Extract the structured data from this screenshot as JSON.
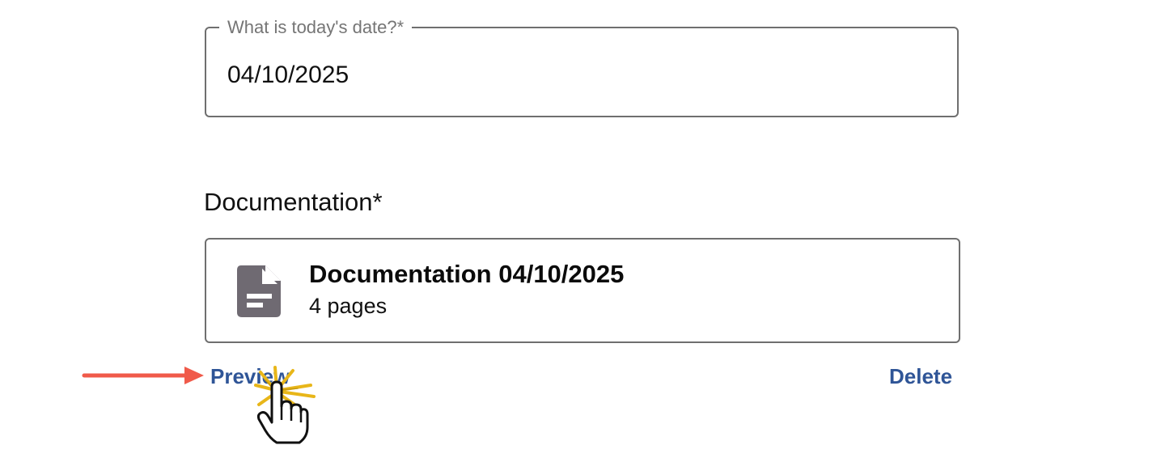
{
  "form": {
    "date_field": {
      "label": "What is today's date?*",
      "value": "04/10/2025"
    },
    "documentation": {
      "heading": "Documentation*",
      "file": {
        "icon": "document-icon",
        "title": "Documentation 04/10/2025",
        "meta": "4 pages"
      },
      "actions": {
        "preview_label": "Preview",
        "delete_label": "Delete"
      }
    }
  },
  "annotation": {
    "arrow_color": "#f05a4a",
    "burst_color": "#e8b619",
    "cursor_icon": "hand-pointer-icon"
  },
  "colors": {
    "link": "#2f5597",
    "border": "#6f6f6f",
    "icon": "#6f6a72"
  }
}
